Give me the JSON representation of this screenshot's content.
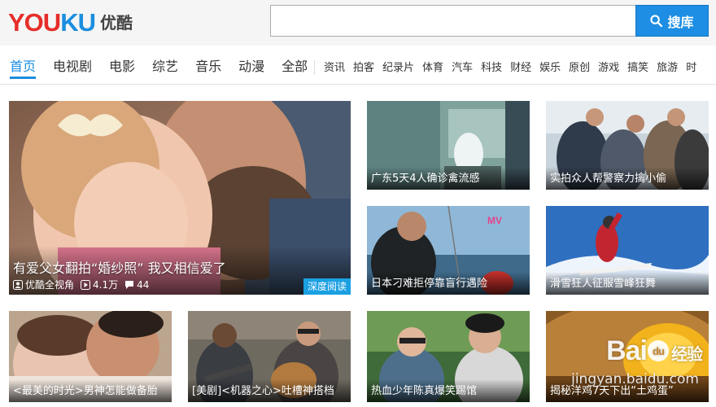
{
  "header": {
    "logo_latin_a": "YOU",
    "logo_latin_b": "KU",
    "logo_cn": "优酷",
    "search_placeholder": "",
    "search_button_label": "搜库"
  },
  "nav": {
    "main": [
      {
        "label": "首页",
        "active": true
      },
      {
        "label": "电视剧"
      },
      {
        "label": "电影"
      },
      {
        "label": "综艺"
      },
      {
        "label": "音乐"
      },
      {
        "label": "动漫"
      },
      {
        "label": "全部"
      }
    ],
    "sub": [
      "资讯",
      "拍客",
      "纪录片",
      "体育",
      "汽车",
      "科技",
      "财经",
      "娱乐",
      "原创",
      "游戏",
      "搞笑",
      "旅游",
      "时"
    ]
  },
  "featured": {
    "title": "有爱父女翻拍“婚纱照” 我又相信爱了",
    "channel": "优酷全视角",
    "plays": "4.1万",
    "comments": "44",
    "badge": "深度阅读"
  },
  "tiles": [
    {
      "caption": "广东5天4人确诊禽流感"
    },
    {
      "caption": "实拍众人帮警察力擒小偷"
    },
    {
      "caption": "日本刁难拒停靠盲行遇险"
    },
    {
      "caption": "滑雪狂人征服雪峰狂舞"
    },
    {
      "caption": "<最美的时光>男神怎能做备胎"
    },
    {
      "caption": "[美剧]<机器之心>吐槽神搭档"
    },
    {
      "caption": "热血少年陈真爆笑踢馆"
    },
    {
      "caption": "揭秘洋鸡7天下出“土鸡蛋”"
    }
  ],
  "watermark": {
    "brand": "Bai",
    "brand_cn": "经验",
    "site": "jingyan.baidu.com"
  },
  "colors": {
    "accent": "#1a8ee0",
    "logo_red": "#e62e2a",
    "badge": "#1ba0e2"
  }
}
